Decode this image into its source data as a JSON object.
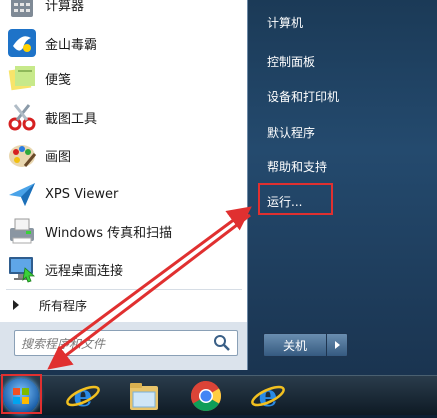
{
  "programs": [
    {
      "label": "计算器",
      "icon": "calculator-icon"
    },
    {
      "label": "金山毒霸",
      "icon": "antivirus-icon"
    },
    {
      "label": "便笺",
      "icon": "sticky-notes-icon"
    },
    {
      "label": "截图工具",
      "icon": "snipping-tool-icon"
    },
    {
      "label": "画图",
      "icon": "paint-icon"
    },
    {
      "label": "XPS Viewer",
      "icon": "xps-viewer-icon"
    },
    {
      "label": "Windows 传真和扫描",
      "icon": "fax-scan-icon"
    },
    {
      "label": "远程桌面连接",
      "icon": "remote-desktop-icon"
    }
  ],
  "all_programs": "所有程序",
  "search": {
    "placeholder": "搜索程序和文件"
  },
  "right_items": [
    "计算机",
    "控制面板",
    "设备和打印机",
    "默认程序",
    "帮助和支持",
    "运行..."
  ],
  "shutdown": {
    "label": "关机"
  },
  "taskbar": [
    "start-orb",
    "internet-explorer-icon",
    "file-explorer-icon",
    "chrome-icon",
    "internet-explorer-icon"
  ],
  "colors": {
    "annotation": "#e03030",
    "menu_bg": "#244a6e"
  }
}
